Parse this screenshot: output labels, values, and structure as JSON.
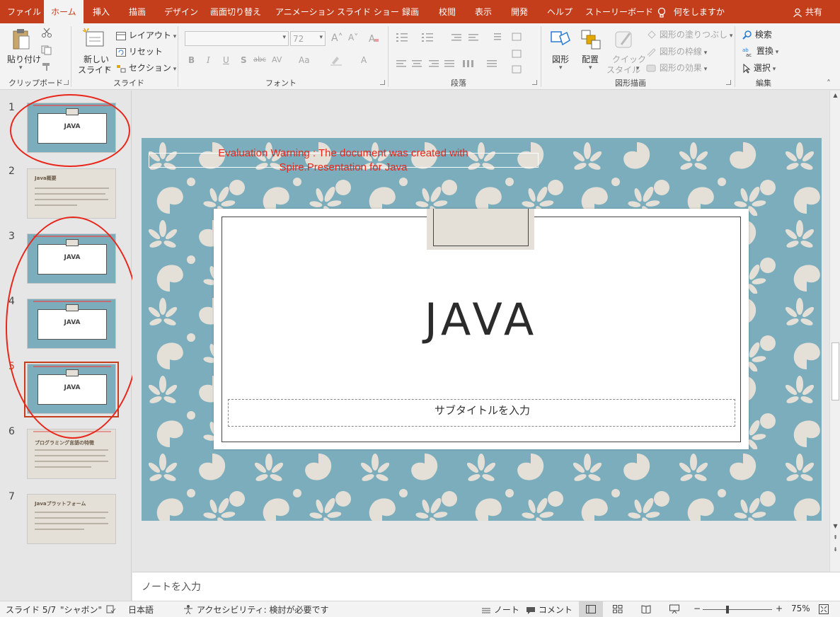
{
  "tabs": [
    "ファイル",
    "ホーム",
    "挿入",
    "描画",
    "デザイン",
    "画面切り替え",
    "アニメーション",
    "スライド ショー",
    "録画",
    "校閲",
    "表示",
    "開発",
    "ヘルプ",
    "ストーリーボード"
  ],
  "tell_me": "何をしますか",
  "share": "共有",
  "clipboard": {
    "paste": "貼り付け",
    "label": "クリップボード"
  },
  "slides_grp": {
    "new_slide_1": "新しい",
    "new_slide_2": "スライド",
    "layout": "レイアウト",
    "reset": "リセット",
    "section": "セクション",
    "label": "スライド"
  },
  "font": {
    "size": "72",
    "label": "フォント",
    "bold": "B",
    "italic": "I",
    "underline": "U",
    "shadow": "S",
    "strike": "abc",
    "spacing": "AV",
    "case": "Aa"
  },
  "paragraph": {
    "label": "段落"
  },
  "drawing": {
    "shapes": "図形",
    "arrange": "配置",
    "quick_style_1": "クイック",
    "quick_style_2": "スタイル",
    "fill": "図形の塗りつぶし",
    "outline": "図形の枠線",
    "effects": "図形の効果",
    "label": "図形描画"
  },
  "editing": {
    "find": "検索",
    "replace": "置換",
    "select": "選択",
    "label": "編集"
  },
  "thumbnails": [
    {
      "num": "1",
      "style": "pattern",
      "title": "JAVA"
    },
    {
      "num": "2",
      "style": "beige",
      "title": "Java概要"
    },
    {
      "num": "3",
      "style": "pattern",
      "title": "JAVA"
    },
    {
      "num": "4",
      "style": "pattern",
      "title": "JAVA"
    },
    {
      "num": "5",
      "style": "pattern",
      "title": "JAVA"
    },
    {
      "num": "6",
      "style": "beige",
      "title": "プログラミング言語の特徴"
    },
    {
      "num": "7",
      "style": "beige",
      "title": "Javaプラットフォーム"
    }
  ],
  "selected_slide": "5",
  "slide": {
    "warning": "Evaluation Warning : The document was created with  Spire.Presentation for Java",
    "title": "JAVA",
    "subtitle_placeholder": "サブタイトルを入力"
  },
  "notes_placeholder": "ノートを入力",
  "status": {
    "slide_info": "スライド 5/7",
    "theme": "\"シャボン\"",
    "language": "日本語",
    "accessibility": "アクセシビリティ: 検討が必要です",
    "notes": "ノート",
    "comments": "コメント",
    "zoom": "75%",
    "zoom_minus": "−",
    "zoom_plus": "+"
  },
  "colors": {
    "accent": "#c43e1c",
    "slide_bg": "#7cadbc",
    "pattern": "#e4e0d7",
    "warning": "#e8261a"
  }
}
